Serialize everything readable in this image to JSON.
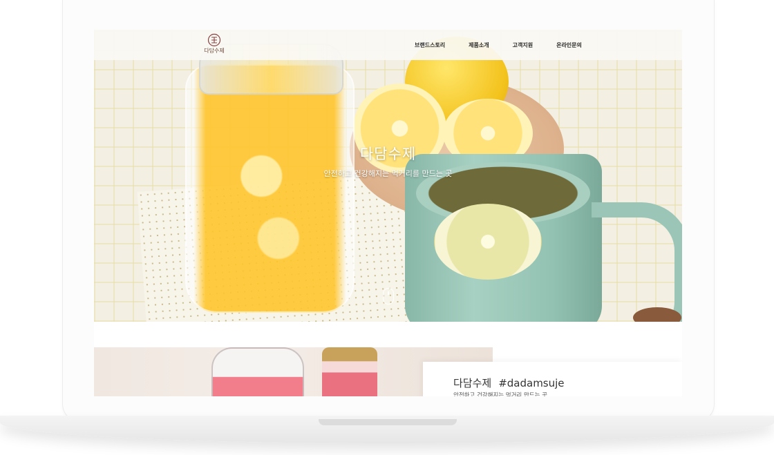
{
  "site": {
    "logo_text": "다담수제"
  },
  "nav": {
    "items": [
      {
        "label": "브랜드스토리"
      },
      {
        "label": "제품소개"
      },
      {
        "label": "고객지원"
      },
      {
        "label": "온라인문의"
      }
    ]
  },
  "hero": {
    "title": "다담수제",
    "subtitle": "안전하고 건강해지는 먹거리를 만드는 곳"
  },
  "intro": {
    "title": "다담수제",
    "tag": "#dadamsuje",
    "subtitle": "안전하고 건강해지는 먹거리 만드는 곳"
  },
  "colors": {
    "logo": "#6b4a3a",
    "mug": "#9bc6b7",
    "lemon": "#f3c21c"
  }
}
